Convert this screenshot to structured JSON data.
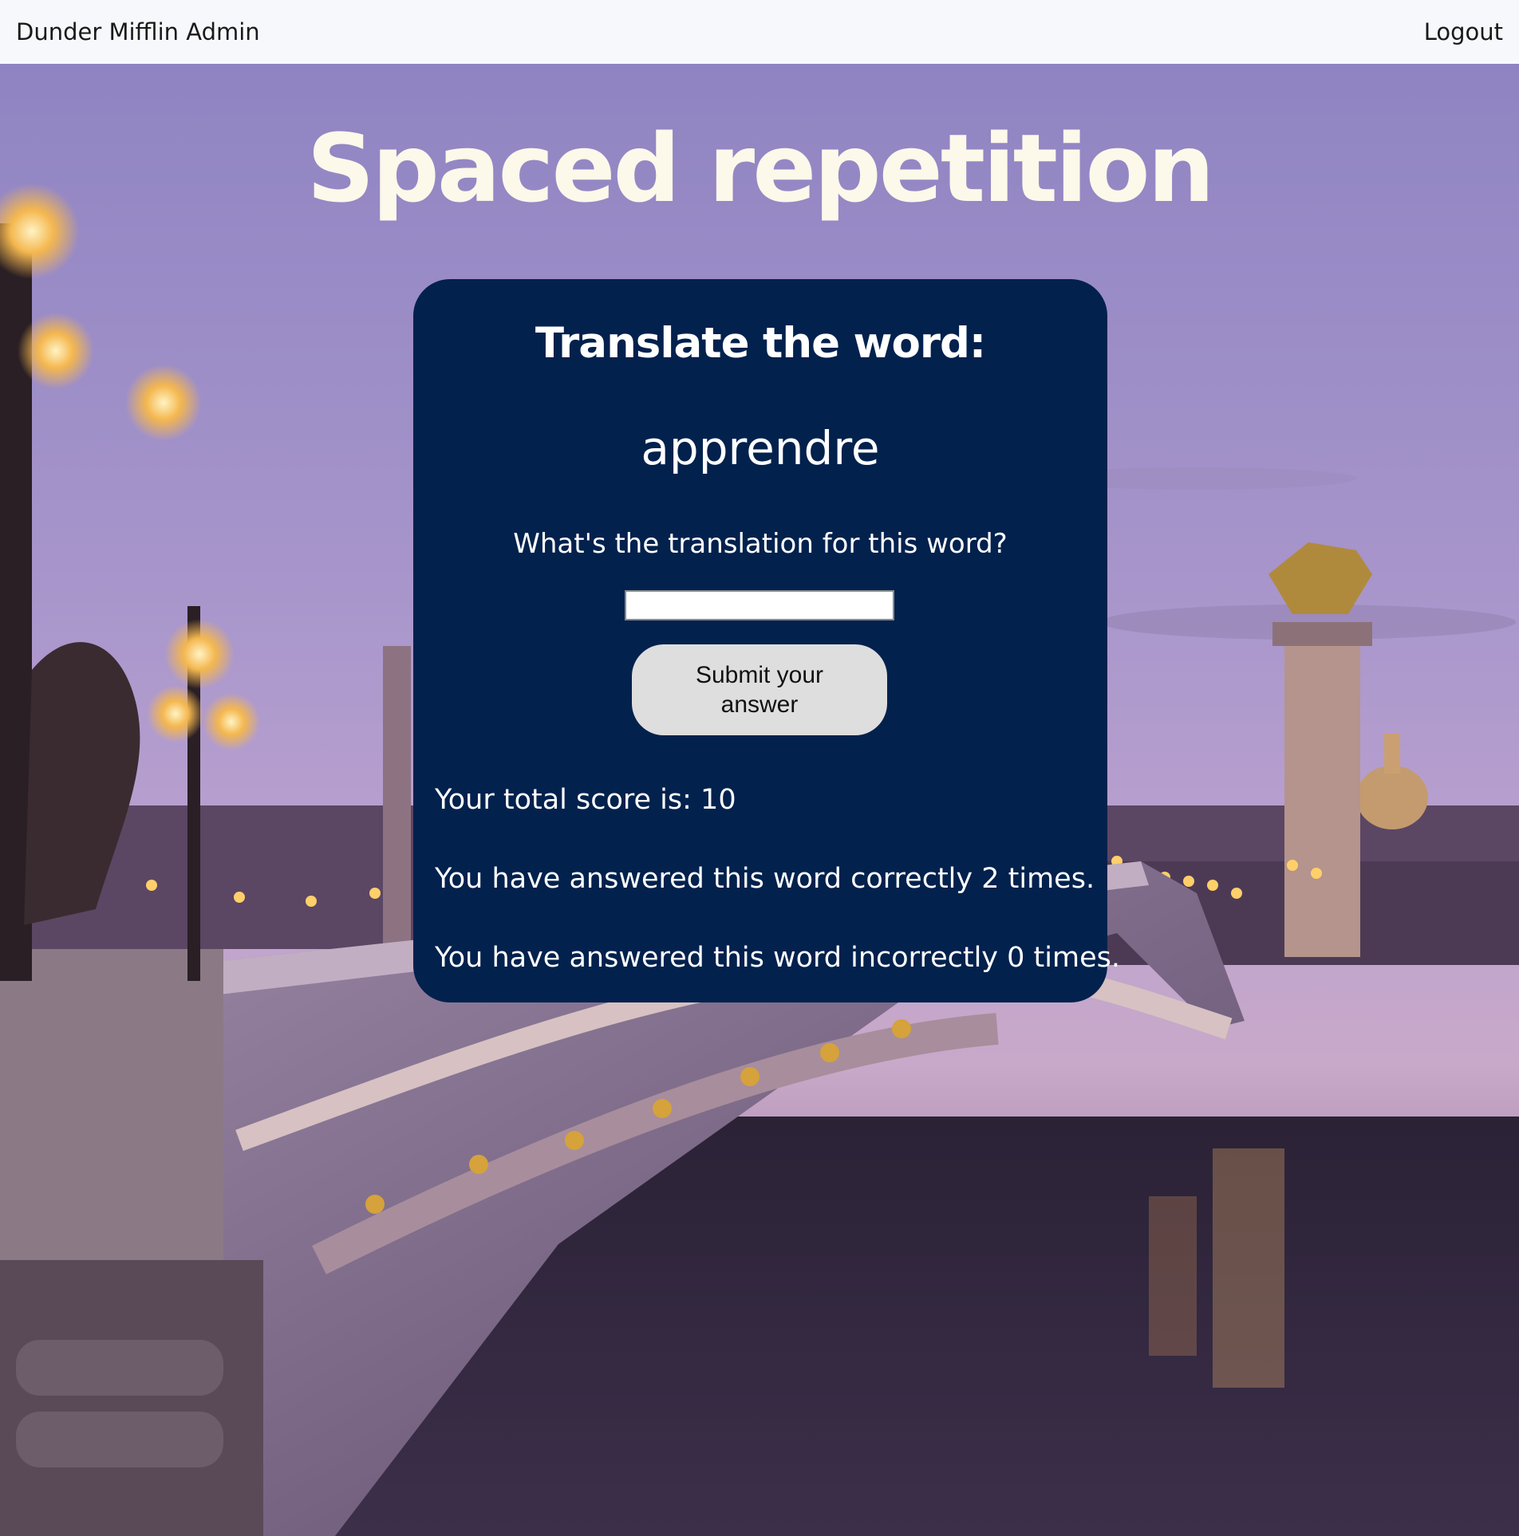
{
  "header": {
    "brand": "Dunder Mifflin Admin",
    "logout_label": "Logout"
  },
  "page": {
    "title": "Spaced repetition",
    "background_image": "Alexandre III bridge over the Seine at dusk with ornate lamps and gilded statues"
  },
  "card": {
    "heading": "Translate the word:",
    "word": "apprendre",
    "prompt": "What's the translation for this word?",
    "answer_value": "",
    "submit_label": "Submit your answer",
    "score_text": "Your total score is: 10",
    "correct_text": "You have answered this word correctly 2 times.",
    "incorrect_text": "You have answered this word incorrectly 0 times."
  },
  "colors": {
    "header_bg": "#f7f8fc",
    "title": "#fcf8ea",
    "card_bg": "#02214d",
    "button_bg": "#dedede"
  }
}
